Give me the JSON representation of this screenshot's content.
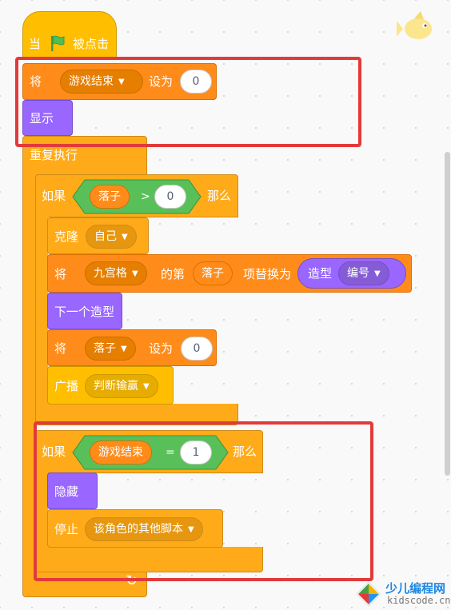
{
  "hat": {
    "when": "当",
    "clicked": "被点击",
    "flag_icon": "green-flag-icon"
  },
  "set_game_over": {
    "set": "将",
    "variable": "游戏结束",
    "to": "设为",
    "value": "0"
  },
  "show": "显示",
  "forever": "重复执行",
  "if1": {
    "if": "如果",
    "then": "那么",
    "left_var": "落子",
    "operator": ">",
    "right_value": "0"
  },
  "clone": {
    "label": "克隆",
    "target": "自己"
  },
  "replace_item": {
    "set": "将",
    "list": "九宫格",
    "of": "的第",
    "index_var": "落子",
    "replace_with": "项替换为",
    "costume_label": "造型",
    "costume_option": "编号"
  },
  "next_costume": "下一个造型",
  "set_luozi": {
    "set": "将",
    "variable": "落子",
    "to": "设为",
    "value": "0"
  },
  "broadcast": {
    "label": "广播",
    "message": "判断输赢"
  },
  "if2": {
    "if": "如果",
    "then": "那么",
    "left_var": "游戏结束",
    "operator": "=",
    "right_value": "1"
  },
  "hide": "隐藏",
  "stop": {
    "label": "停止",
    "option": "该角色的其他脚本"
  },
  "loop_arrow": "↻",
  "watermark": {
    "site_cn": "少儿编程网",
    "site_en": "kidscode.cn"
  },
  "colors": {
    "events": "#ffbf00",
    "control": "#ffab19",
    "variables": "#ff8c1a",
    "looks": "#9966ff",
    "operators": "#59c059",
    "highlight": "#e23a3a"
  }
}
